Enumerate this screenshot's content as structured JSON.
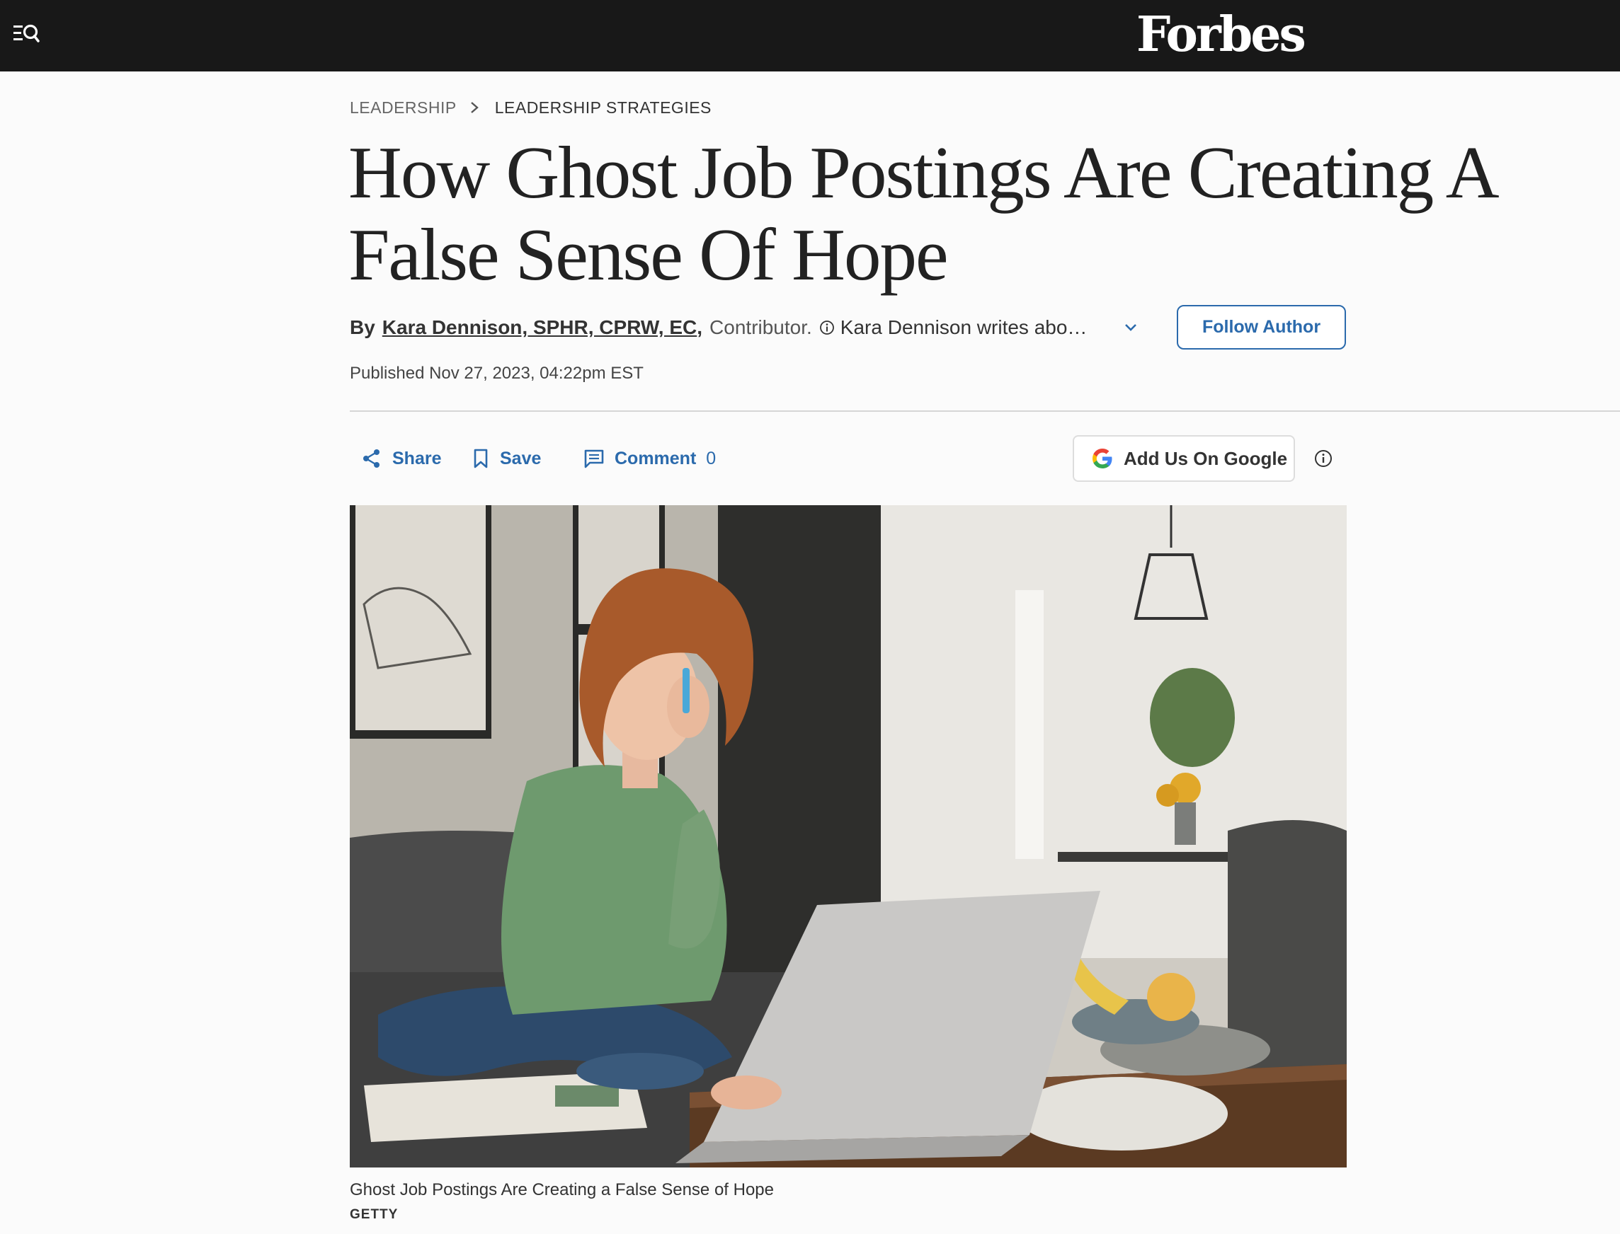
{
  "header": {
    "brand": "Forbes",
    "menu_icon": "menu-search-icon"
  },
  "breadcrumb": {
    "section": "LEADERSHIP",
    "subsection": "LEADERSHIP STRATEGIES",
    "separator_icon": "chevron-right-icon"
  },
  "article": {
    "headline": "How Ghost Job Postings Are Creating A False Sense Of Hope",
    "byline": {
      "by_label": "By",
      "author": "Kara Dennison, SPHR, CPRW, EC",
      "comma": ",",
      "role": "Contributor.",
      "about": "Kara Dennison writes about career development and leadership",
      "expand_icon": "chevron-down-icon",
      "follow_label": "Follow Author"
    },
    "published": "Published Nov 27, 2023, 04:22pm EST"
  },
  "actions": {
    "share_label": "Share",
    "save_label": "Save",
    "comment_label": "Comment",
    "comment_count": "0",
    "google_label": "Add Us On Google"
  },
  "hero": {
    "caption": "Ghost Job Postings Are Creating a False Sense of Hope",
    "credit": "GETTY"
  },
  "colors": {
    "topbar": "#181818",
    "accent": "#2b6aac",
    "text": "#333333",
    "background": "#fbfbfb"
  }
}
